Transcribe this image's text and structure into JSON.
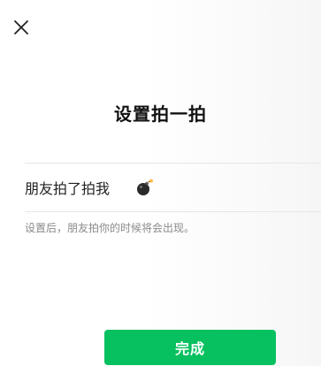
{
  "header": {
    "close_icon": "close-icon"
  },
  "title": "设置拍一拍",
  "field": {
    "label": "朋友拍了拍我",
    "value_icon": "bomb-emoji"
  },
  "hint": "设置后，朋友拍你的时候将会出现。",
  "done_button": {
    "label": "完成",
    "color": "#07c160"
  }
}
